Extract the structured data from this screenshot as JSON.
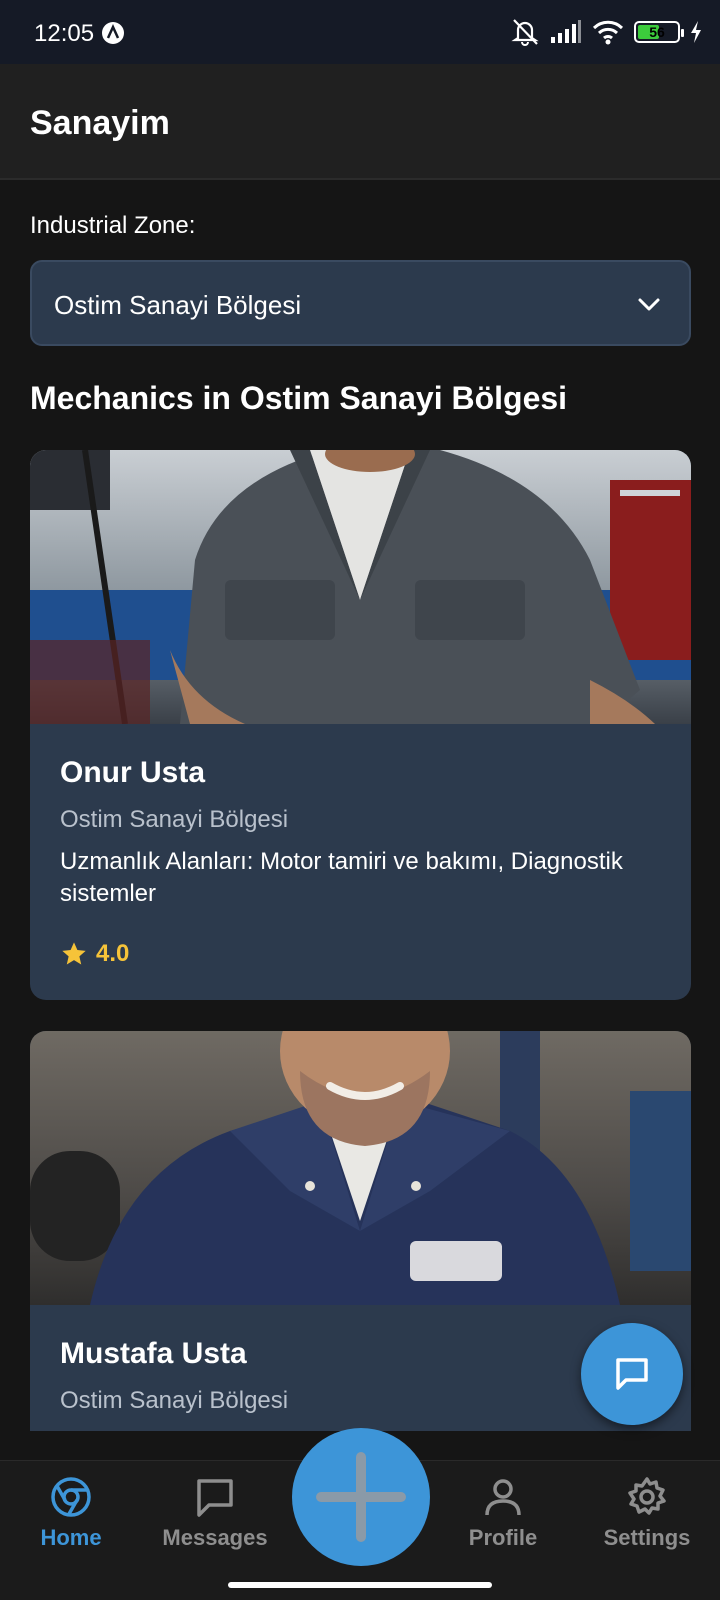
{
  "status_bar": {
    "time": "12:05",
    "battery_level": "56",
    "battery_fraction": 0.56,
    "icons": [
      "notifications-off-icon",
      "signal-icon",
      "wifi-icon",
      "battery-icon",
      "charging-icon"
    ]
  },
  "app_bar": {
    "title": "Sanayim"
  },
  "zone": {
    "label": "Industrial Zone:",
    "selected": "Ostim Sanayi Bölgesi"
  },
  "section_title": "Mechanics in Ostim Sanayi Bölgesi",
  "mechanics": [
    {
      "name": "Onur Usta",
      "zone": "Ostim Sanayi Bölgesi",
      "specialties": "Uzmanlık Alanları: Motor tamiri ve bakımı, Diagnostik sistemler",
      "rating": "4.0"
    },
    {
      "name": "Mustafa Usta",
      "zone": "Ostim Sanayi Bölgesi"
    }
  ],
  "bottom_nav": {
    "items": [
      {
        "label": "Home",
        "icon": "home-icon",
        "active": true
      },
      {
        "label": "Messages",
        "icon": "message-icon",
        "active": false
      },
      {
        "label": "Profile",
        "icon": "person-icon",
        "active": false
      },
      {
        "label": "Settings",
        "icon": "gear-icon",
        "active": false
      }
    ],
    "center_action_icon": "plus-icon"
  },
  "colors": {
    "accent": "#3d95d8",
    "card_background": "#2c3a4d",
    "page_background": "#151515",
    "rating_star": "#f6c339"
  }
}
